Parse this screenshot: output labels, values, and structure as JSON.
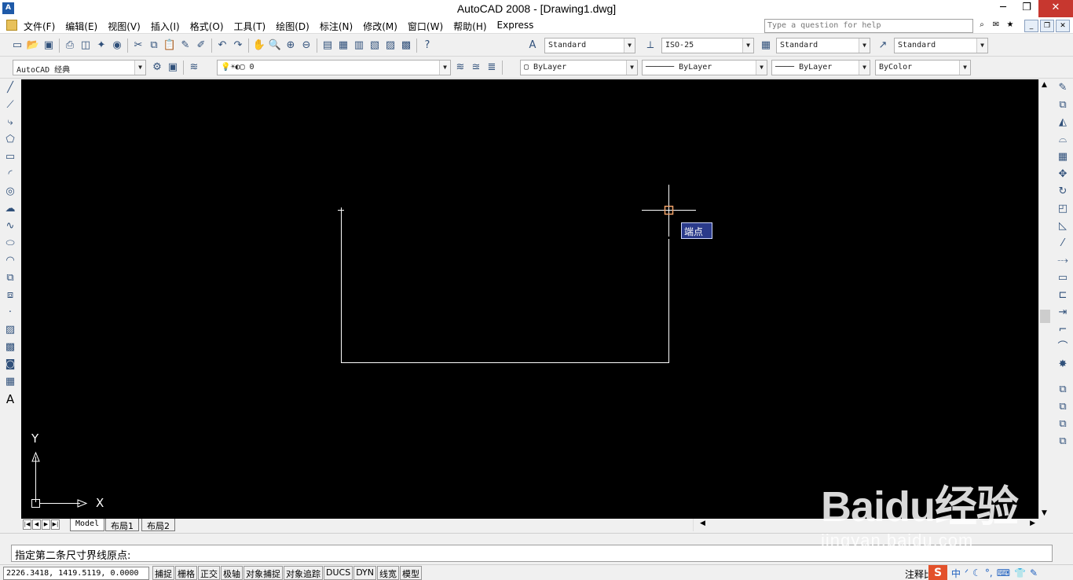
{
  "window": {
    "title": "AutoCAD 2008 - [Drawing1.dwg]",
    "logo_text": "A",
    "min": "─",
    "restore": "❐",
    "close": "✕"
  },
  "menu": {
    "items": [
      "文件(F)",
      "编辑(E)",
      "视图(V)",
      "插入(I)",
      "格式(O)",
      "工具(T)",
      "绘图(D)",
      "标注(N)",
      "修改(M)",
      "窗口(W)",
      "帮助(H)",
      "Express"
    ],
    "help_placeholder": "Type a question for help"
  },
  "toolbar": {
    "text_style": "Standard",
    "dim_style": "ISO-25",
    "table_style": "Standard",
    "multileader_style": "Standard",
    "workspace": "AutoCAD 经典",
    "layer": "0",
    "color": "ByLayer",
    "linetype": "ByLayer",
    "lineweight": "ByLayer",
    "plotstyle": "ByColor"
  },
  "tooltip": {
    "text": "端点"
  },
  "ucs": {
    "x_label": "X",
    "y_label": "Y"
  },
  "tabs": {
    "model": "Model",
    "layout1": "布局1",
    "layout2": "布局2"
  },
  "command": {
    "prompt": "指定第二条尺寸界线原点:"
  },
  "status": {
    "coords": "2226.3418, 1419.5119, 0.0000",
    "toggles": [
      "捕捉",
      "栅格",
      "正交",
      "极轴",
      "对象捕捉",
      "对象追踪",
      "DUCS",
      "DYN",
      "线宽",
      "模型"
    ],
    "annotation": "注释比"
  },
  "tray": {
    "ime": "中"
  },
  "watermark": {
    "brand": "Baidu经验",
    "url": "jingyan.baidu.com"
  },
  "icons": {
    "left": [
      "line-icon",
      "construction-line-icon",
      "polyline-icon",
      "polygon-icon",
      "rectangle-icon",
      "arc-icon",
      "circle-icon",
      "revision-cloud-icon",
      "spline-icon",
      "ellipse-icon",
      "ellipse-arc-icon",
      "insert-block-icon",
      "make-block-icon",
      "point-icon",
      "hatch-icon",
      "gradient-icon",
      "region-icon",
      "table-icon",
      "mtext-icon"
    ],
    "right": [
      "erase-icon",
      "copy-icon",
      "mirror-icon",
      "offset-icon",
      "array-icon",
      "move-icon",
      "rotate-icon",
      "scale-icon",
      "stretch-icon",
      "trim-icon",
      "extend-icon",
      "break-at-point-icon",
      "break-icon",
      "join-icon",
      "chamfer-icon",
      "fillet-icon",
      "explode-icon",
      "draworder-front-icon",
      "draworder-back-icon",
      "draworder-above-icon",
      "draworder-under-icon"
    ]
  }
}
